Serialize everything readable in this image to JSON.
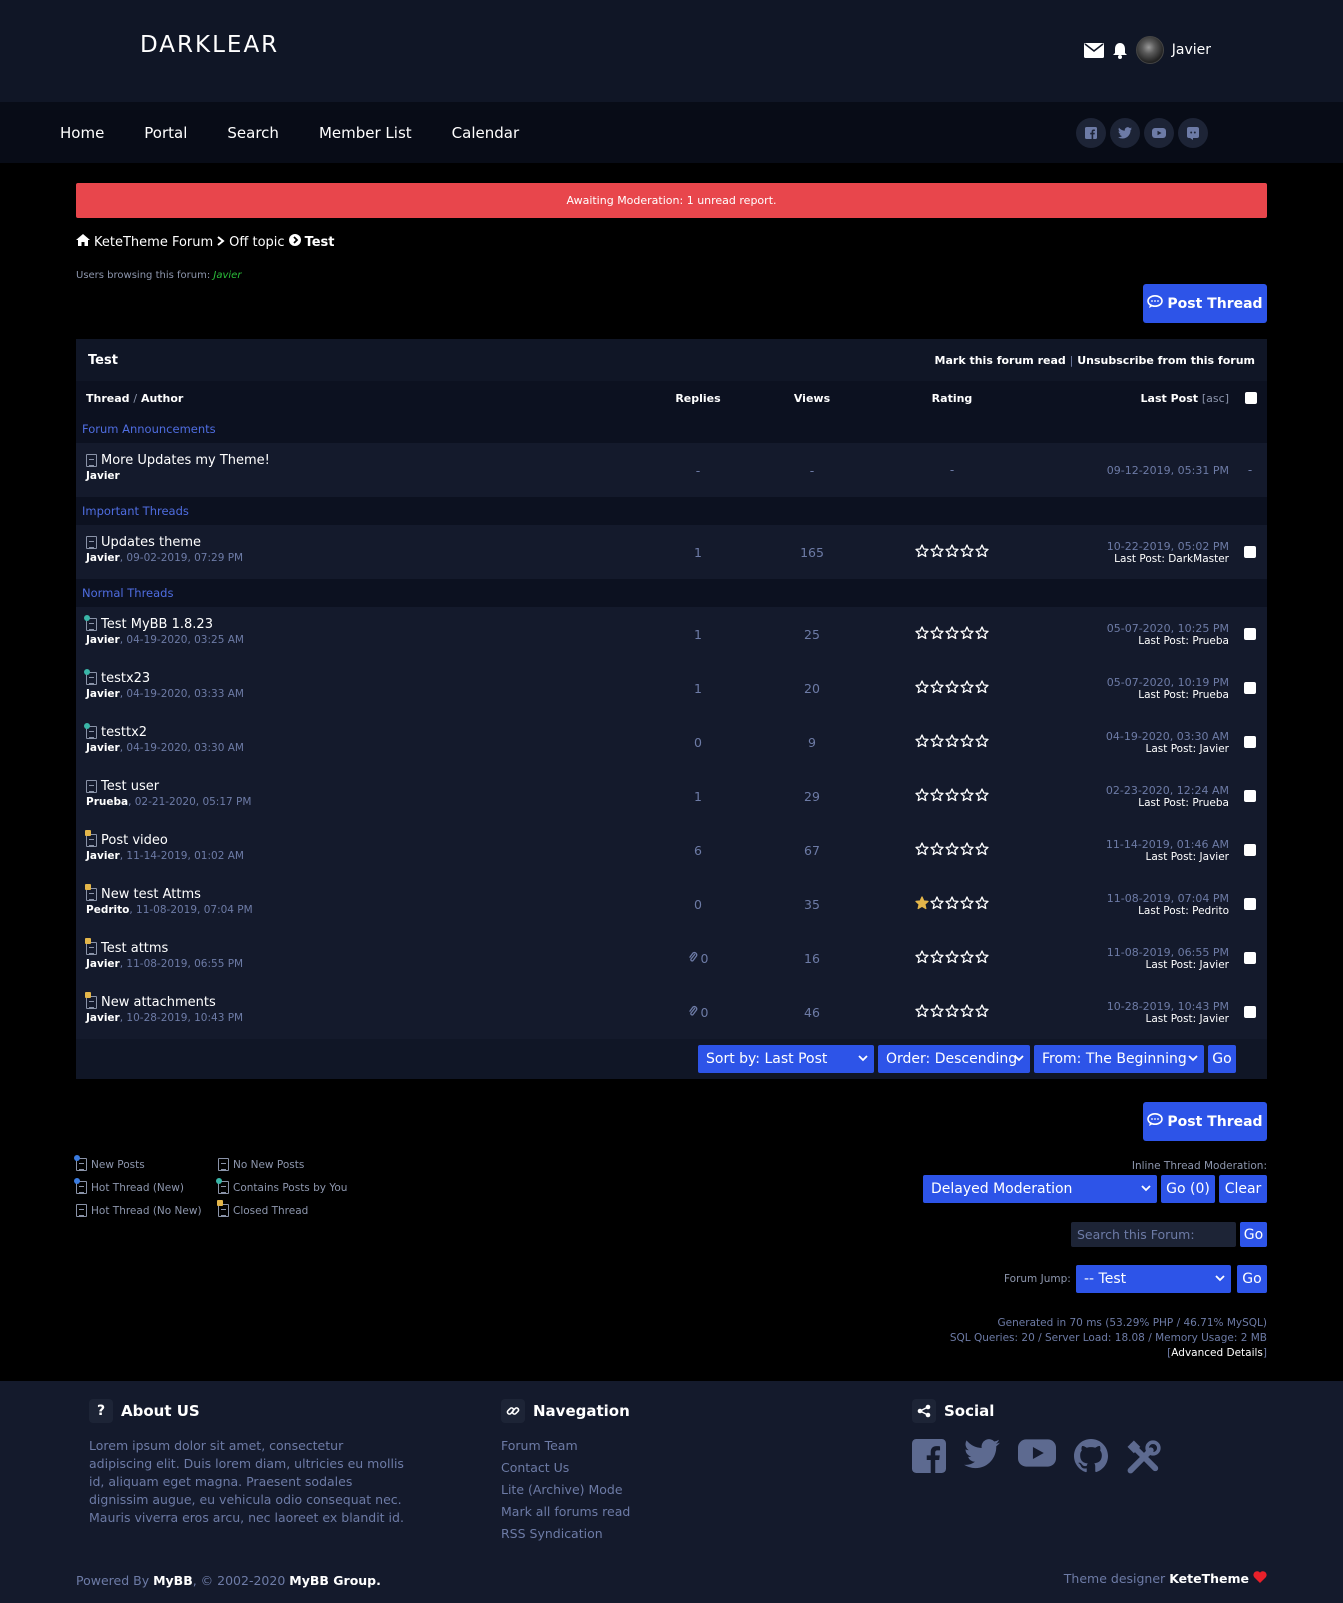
{
  "site": {
    "logo": "DARKLEAR",
    "username": "Javier"
  },
  "nav": [
    "Home",
    "Portal",
    "Search",
    "Member List",
    "Calendar"
  ],
  "alert": "Awaiting Moderation: 1 unread report.",
  "breadcrumb": {
    "home": "KeteTheme Forum",
    "parent": "Off topic",
    "current": "Test"
  },
  "browsing": {
    "label": "Users browsing this forum:",
    "user": "Javier"
  },
  "post_thread_label": "Post Thread",
  "table": {
    "title": "Test",
    "mark_read": "Mark this forum read",
    "separator": "|",
    "unsubscribe": "Unsubscribe from this forum",
    "columns": {
      "thread": "Thread",
      "slash": "/",
      "author": "Author",
      "replies": "Replies",
      "views": "Views",
      "rating": "Rating",
      "lastpost": "Last Post",
      "asc": "[asc]"
    },
    "sections": {
      "announcements": "Forum Announcements",
      "important": "Important Threads",
      "normal": "Normal Threads"
    },
    "announcement": {
      "title": "More Updates my Theme!",
      "author": "Javier",
      "replies": "-",
      "views": "-",
      "rating": "-",
      "date": "09-12-2019, 05:31 PM",
      "extra": "-"
    },
    "important": [
      {
        "title": "Updates theme",
        "author": "Javier",
        "date": ", 09-02-2019, 07:29 PM",
        "replies": "1",
        "views": "165",
        "last_date": "10-22-2019, 05:02 PM",
        "last_label": "Last Post:",
        "last_user": "DarkMaster"
      }
    ],
    "normal": [
      {
        "title": "Test MyBB 1.8.23",
        "author": "Javier",
        "date": ", 04-19-2020, 03:25 AM",
        "replies": "1",
        "views": "25",
        "last_date": "05-07-2020, 10:25 PM",
        "last_label": "Last Post:",
        "last_user": "Prueba",
        "icon": "dot",
        "rating": 0
      },
      {
        "title": "testx23",
        "author": "Javier",
        "date": ", 04-19-2020, 03:33 AM",
        "replies": "1",
        "views": "20",
        "last_date": "05-07-2020, 10:19 PM",
        "last_label": "Last Post:",
        "last_user": "Prueba",
        "icon": "dot",
        "rating": 0
      },
      {
        "title": "testtx2",
        "author": "Javier",
        "date": ", 04-19-2020, 03:30 AM",
        "replies": "0",
        "views": "9",
        "last_date": "04-19-2020, 03:30 AM",
        "last_label": "Last Post:",
        "last_user": "Javier",
        "icon": "dot",
        "rating": 0
      },
      {
        "title": "Test user",
        "author": "Prueba",
        "date": ", 02-21-2020, 05:17 PM",
        "replies": "1",
        "views": "29",
        "last_date": "02-23-2020, 12:24 AM",
        "last_label": "Last Post:",
        "last_user": "Prueba",
        "icon": "none",
        "rating": 0
      },
      {
        "title": "Post video",
        "author": "Javier",
        "date": ", 11-14-2019, 01:02 AM",
        "replies": "6",
        "views": "67",
        "last_date": "11-14-2019, 01:46 AM",
        "last_label": "Last Post:",
        "last_user": "Javier",
        "icon": "lock",
        "rating": 0
      },
      {
        "title": "New test Attms",
        "author": "Pedrito",
        "date": ", 11-08-2019, 07:04 PM",
        "replies": "0",
        "views": "35",
        "last_date": "11-08-2019, 07:04 PM",
        "last_label": "Last Post:",
        "last_user": "Pedrito",
        "icon": "lock",
        "rating": 1
      },
      {
        "title": "Test attms",
        "author": "Javier",
        "date": ", 11-08-2019, 06:55 PM",
        "replies": "0",
        "views": "16",
        "last_date": "11-08-2019, 06:55 PM",
        "last_label": "Last Post:",
        "last_user": "Javier",
        "icon": "lock",
        "rating": 0,
        "attach": true
      },
      {
        "title": "New attachments",
        "author": "Javier",
        "date": ", 10-28-2019, 10:43 PM",
        "replies": "0",
        "views": "46",
        "last_date": "10-28-2019, 10:43 PM",
        "last_label": "Last Post:",
        "last_user": "Javier",
        "icon": "lock",
        "rating": 0,
        "attach": true
      }
    ],
    "footer": {
      "sort": "Sort by: Last Post",
      "order": "Order: Descending",
      "from": "From: The Beginning",
      "go": "Go"
    }
  },
  "legend": [
    "New Posts",
    "No New Posts",
    "Hot Thread (New)",
    "Contains Posts by You",
    "Hot Thread (No New)",
    "Closed Thread"
  ],
  "moderation": {
    "label": "Inline Thread Moderation:",
    "select": "Delayed Moderation",
    "go": "Go (0)",
    "clear": "Clear"
  },
  "search": {
    "placeholder": "Search this Forum:",
    "go": "Go"
  },
  "forum_jump": {
    "label": "Forum Jump:",
    "select": "-- Test",
    "go": "Go"
  },
  "stats": {
    "line1": "Generated in 70 ms (53.29% PHP / 46.71% MySQL)",
    "line2": "SQL Queries: 20 / Server Load: 18.08 / Memory Usage: 2 MB",
    "open": "[",
    "adv": "Advanced Details",
    "close": "]"
  },
  "footer": {
    "about_title": "About US",
    "about_text": "Lorem ipsum dolor sit amet, consectetur adipiscing elit. Duis lorem diam, ultricies eu mollis id, aliquam eget magna. Praesent sodales dignissim augue, eu vehicula odio consequat nec. Mauris viverra eros arcu, nec laoreet ex blandit id.",
    "nav_title": "Navegation",
    "nav_links": [
      "Forum Team",
      "Contact Us",
      "Lite (Archive) Mode",
      "Mark all forums read",
      "RSS Syndication"
    ],
    "social_title": "Social",
    "powered_pre": "Powered By",
    "powered_mybb": "MyBB",
    "powered_mid": ", © 2002-2020",
    "powered_group": "MyBB Group.",
    "designer_pre": "Theme designer",
    "designer": "KeteTheme"
  },
  "colors": {
    "accent": "#2d54e8",
    "alert": "#e8464c",
    "header": "#101626",
    "panel": "#141a2c"
  }
}
